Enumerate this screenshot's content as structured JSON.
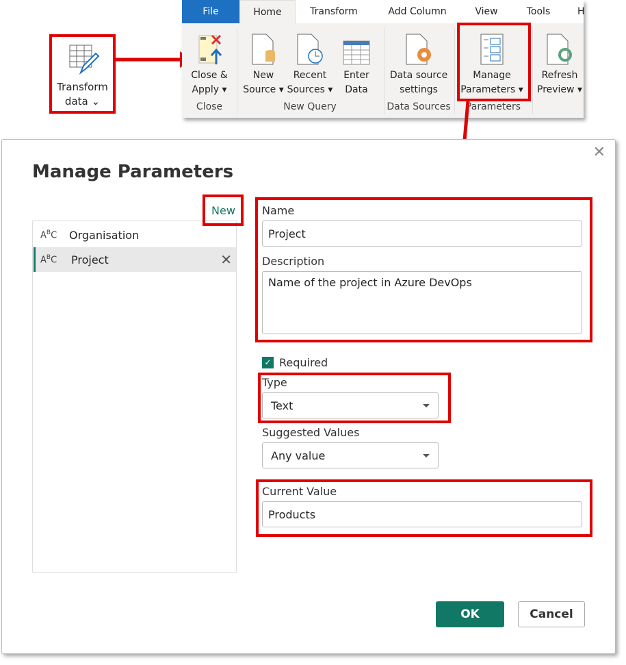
{
  "transform_button": {
    "label_line1": "Transform",
    "label_line2": "data"
  },
  "ribbon": {
    "tabs": [
      "File",
      "Home",
      "Transform",
      "Add Column",
      "View",
      "Tools",
      "H"
    ],
    "active_tab": "Home",
    "buttons": [
      {
        "line1": "Close &",
        "line2": "Apply",
        "icon": "close-apply-icon"
      },
      {
        "line1": "New",
        "line2": "Source",
        "icon": "new-source-icon"
      },
      {
        "line1": "Recent",
        "line2": "Sources",
        "icon": "recent-sources-icon"
      },
      {
        "line1": "Enter",
        "line2": "Data",
        "icon": "table-icon"
      },
      {
        "line1": "Data source",
        "line2": "settings",
        "icon": "gear-document-icon"
      },
      {
        "line1": "Manage",
        "line2": "Parameters",
        "icon": "parameters-icon"
      },
      {
        "line1": "Refresh",
        "line2": "Preview",
        "icon": "refresh-icon"
      }
    ],
    "groups": [
      "Close",
      "New Query",
      "Data Sources",
      "Parameters"
    ]
  },
  "dialog": {
    "title": "Manage Parameters",
    "new_link": "New",
    "parameters": [
      {
        "name": "Organisation",
        "type_icon": "ABC"
      },
      {
        "name": "Project",
        "type_icon": "ABC",
        "selected": true
      }
    ],
    "name_label": "Name",
    "name_value": "Project",
    "description_label": "Description",
    "description_value": "Name of the project in Azure DevOps",
    "required_label": "Required",
    "required_checked": true,
    "type_label": "Type",
    "type_value": "Text",
    "suggested_label": "Suggested Values",
    "suggested_value": "Any value",
    "current_label": "Current Value",
    "current_value": "Products",
    "ok": "OK",
    "cancel": "Cancel"
  },
  "colors": {
    "accent": "#117865",
    "highlight": "#e00000",
    "file_tab": "#1d70c2"
  }
}
